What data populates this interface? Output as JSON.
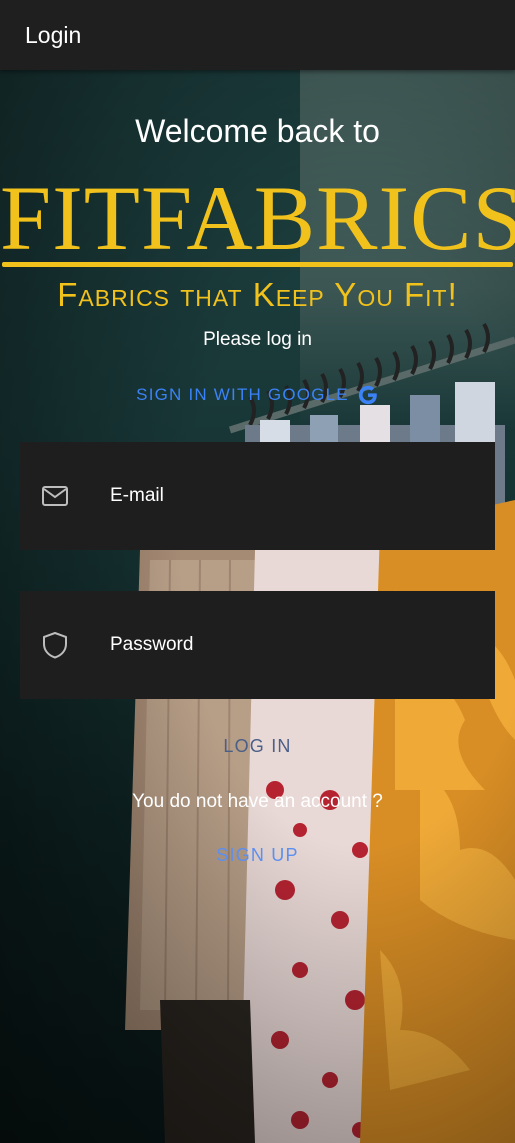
{
  "appbar": {
    "title": "Login"
  },
  "welcome": {
    "text": "Welcome back to"
  },
  "brand": {
    "name": "FITFABRICS",
    "tagline": "Fabrics that Keep You Fit!",
    "color": "#f2c21c"
  },
  "prompt": {
    "text": "Please log in"
  },
  "google": {
    "label": "SIGN IN WITH GOOGLE",
    "icon": "google-icon"
  },
  "form": {
    "email": {
      "placeholder": "E-mail",
      "value": "",
      "icon": "mail-icon"
    },
    "password": {
      "placeholder": "Password",
      "value": "",
      "icon": "shield-icon"
    }
  },
  "login": {
    "label": "LOG IN"
  },
  "signup": {
    "prompt": "You do not have an account ?",
    "label": "SIGN UP"
  },
  "colors": {
    "appbar": "#1f1f1f",
    "field_bg": "#1e1e1e",
    "link": "#3b82f6"
  }
}
